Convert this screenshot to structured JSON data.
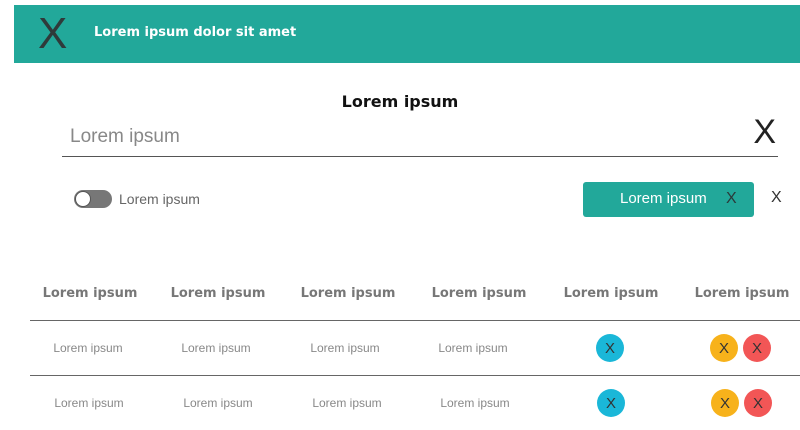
{
  "header": {
    "menu_icon_glyph": "X",
    "title": "Lorem ipsum dolor sit amet",
    "background": "#22a89a"
  },
  "form": {
    "title": "Lorem ipsum",
    "search": {
      "placeholder": "Lorem ipsum",
      "value": "",
      "clear_glyph": "X"
    },
    "toggle": {
      "label": "Lorem ipsum",
      "on": false
    },
    "chip": {
      "label": "Lorem ipsum",
      "close_glyph": "X",
      "color": "#22a89a"
    },
    "outer_close_glyph": "X"
  },
  "table": {
    "headers": [
      "Lorem ipsum",
      "Lorem ipsum",
      "Lorem ipsum",
      "Lorem ipsum",
      "Lorem ipsum",
      "Lorem ipsum"
    ],
    "rows": [
      {
        "cells": [
          "Lorem ipsum",
          "Lorem ipsum",
          "Lorem ipsum",
          "Lorem ipsum"
        ],
        "status_glyph": "X",
        "actions": [
          "X",
          "X"
        ]
      },
      {
        "cells": [
          "Lorem ipsum",
          "Lorem ipsum",
          "Lorem ipsum",
          "Lorem ipsum"
        ],
        "status_glyph": "X",
        "actions": [
          "X",
          "X"
        ]
      }
    ],
    "colors": {
      "status": "#1ab7d8",
      "action_warning": "#f7b21b",
      "action_danger": "#f25656"
    }
  }
}
